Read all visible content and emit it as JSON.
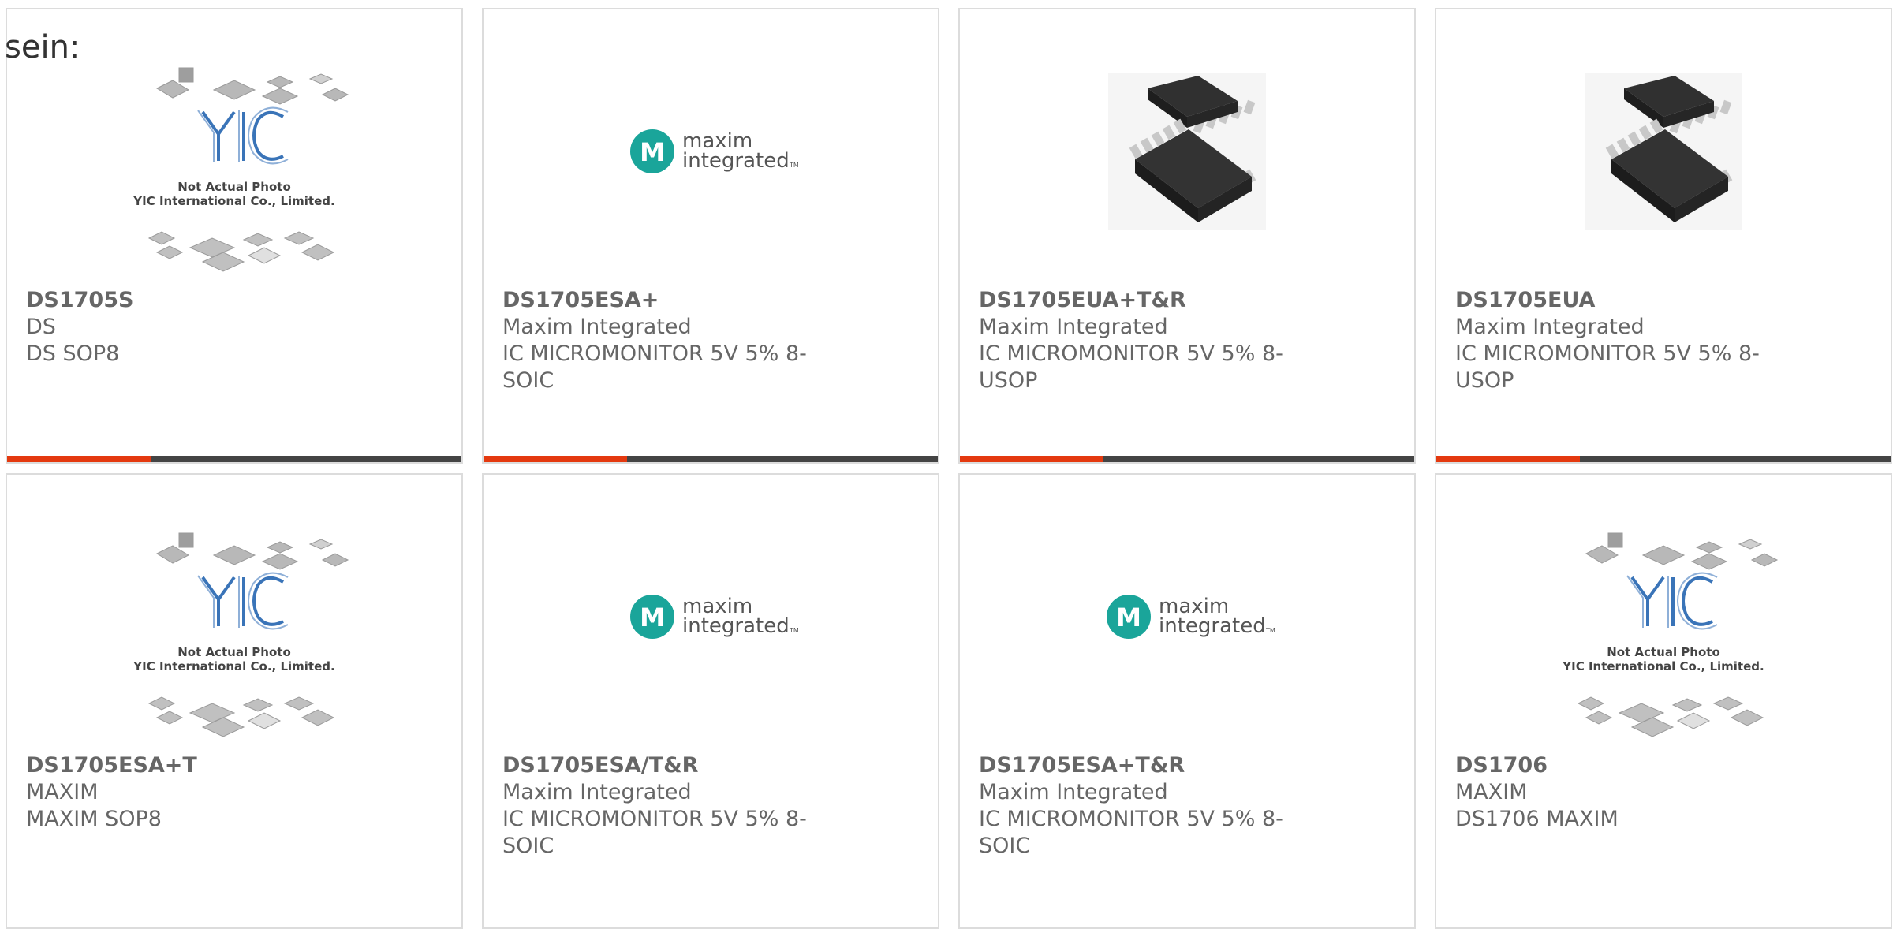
{
  "intro_text": "sein:",
  "colors": {
    "accent": "#e4390f",
    "bar": "#444444",
    "maxim_teal": "#1aa59a",
    "yic_blue": "#2a6fb8",
    "chip": "#303030"
  },
  "placeholder": {
    "line1": "Not Actual Photo",
    "line2": "YIC International Co., Limited.",
    "logo_text": "YIC"
  },
  "maxim_logo": {
    "word1": "maxim",
    "word2": "integrated",
    "tm": "TM"
  },
  "products": [
    {
      "part": "DS1705S",
      "mfr": "DS",
      "desc": "DS SOP8",
      "image": "yic-placeholder"
    },
    {
      "part": "DS1705ESA+",
      "mfr": "Maxim Integrated",
      "desc": "IC MICROMONITOR 5V 5% 8-SOIC",
      "image": "maxim-logo"
    },
    {
      "part": "DS1705EUA+T&R",
      "mfr": "Maxim Integrated",
      "desc": "IC MICROMONITOR 5V 5% 8-USOP",
      "image": "chip-photo"
    },
    {
      "part": "DS1705EUA",
      "mfr": "Maxim Integrated",
      "desc": "IC MICROMONITOR 5V 5% 8-USOP",
      "image": "chip-photo"
    },
    {
      "part": "DS1705ESA+T",
      "mfr": "MAXIM",
      "desc": "MAXIM SOP8",
      "image": "yic-placeholder"
    },
    {
      "part": "DS1705ESA/T&R",
      "mfr": "Maxim Integrated",
      "desc": "IC MICROMONITOR 5V 5% 8-SOIC",
      "image": "maxim-logo"
    },
    {
      "part": "DS1705ESA+T&R",
      "mfr": "Maxim Integrated",
      "desc": "IC MICROMONITOR 5V 5% 8-SOIC",
      "image": "maxim-logo"
    },
    {
      "part": "DS1706",
      "mfr": "MAXIM",
      "desc": "DS1706 MAXIM",
      "image": "yic-placeholder"
    }
  ]
}
